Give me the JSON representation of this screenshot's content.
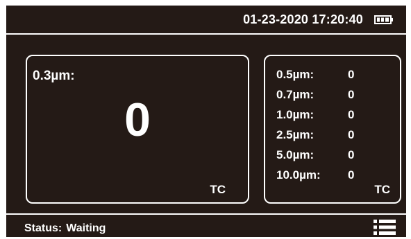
{
  "header": {
    "date": "01-23-2020",
    "time": "17:20:40",
    "battery_icon": "battery-icon"
  },
  "main_panel": {
    "label": "0.3µm:",
    "value": "0",
    "unit": "TC"
  },
  "side_panel": {
    "rows": [
      {
        "label": "0.5µm:",
        "value": "0"
      },
      {
        "label": "0.7µm:",
        "value": "0"
      },
      {
        "label": "1.0µm:",
        "value": "0"
      },
      {
        "label": "2.5µm:",
        "value": "0"
      },
      {
        "label": "5.0µm:",
        "value": "0"
      },
      {
        "label": "10.0µm:",
        "value": "0"
      }
    ],
    "unit": "TC"
  },
  "status_bar": {
    "label": "Status:",
    "value": "Waiting",
    "menu_icon": "menu-list-icon"
  },
  "colors": {
    "background": "#241a16",
    "foreground": "#ffffff"
  }
}
